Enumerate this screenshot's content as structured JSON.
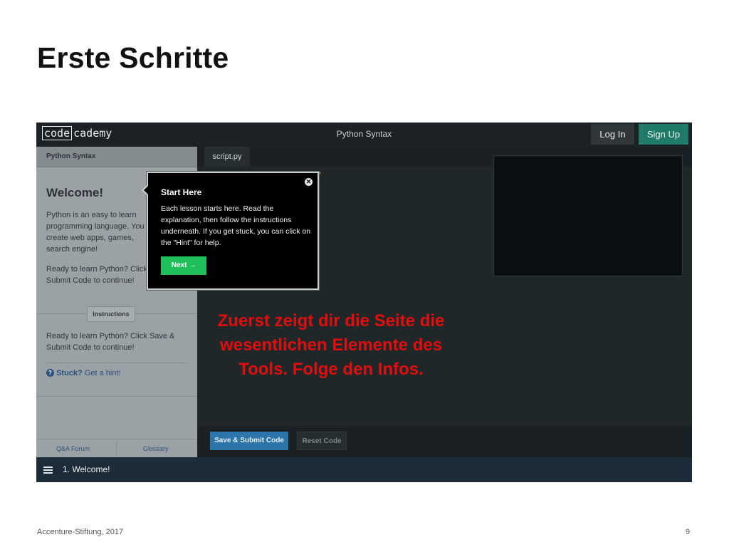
{
  "slide": {
    "title": "Erste Schritte",
    "footer_left": "Accenture-Stiftung, 2017",
    "page_number": "9",
    "annotation": "Zuerst zeigt dir die Seite die wesentlichen Elemente des Tools. Folge den Infos."
  },
  "app": {
    "logo_code": "code",
    "logo_rest": "cademy",
    "page_title": "Python Syntax",
    "login_label": "Log In",
    "signup_label": "Sign Up",
    "accent_color": "#1f7a6a"
  },
  "sidebar": {
    "header": "Python Syntax",
    "welcome": "Welcome!",
    "intro": "Python is an easy to learn programming language. You to create web apps, games, search engine!",
    "ready_text": "Ready to learn Python? Click Submit Code to continue!",
    "instructions_label": "Instructions",
    "instructions_text": "Ready to learn Python? Click Save & Submit Code to continue!",
    "stuck_icon": "?",
    "stuck_label": "Stuck?",
    "hint_link": "Get a hint!",
    "forum_link": "Q&A Forum",
    "glossary_link": "Glossary"
  },
  "editor": {
    "tab_label": "script.py",
    "save_button": "Save & Submit Code",
    "reset_button": "Reset Code"
  },
  "popover": {
    "title": "Start Here",
    "body": "Each lesson starts here. Read the explanation, then follow the instructions underneath. If you get stuck, you can click on the \"Hint\" for help.",
    "next_label": "Next →",
    "close_icon": "✕"
  },
  "bottombar": {
    "lesson": "1. Welcome!"
  }
}
